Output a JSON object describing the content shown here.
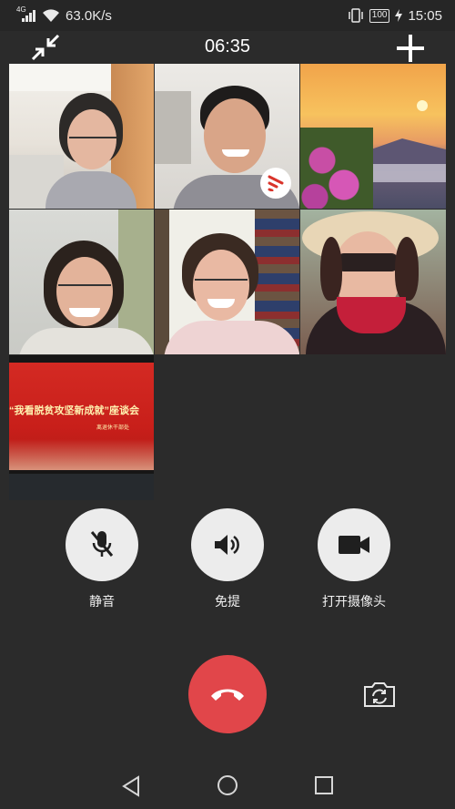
{
  "status_bar": {
    "network_type": "4G",
    "speed": "63.0K/s",
    "battery": "100",
    "time": "15:05"
  },
  "call": {
    "timer": "06:35"
  },
  "banner": {
    "title": "“我看脱贫攻坚新成就”座谈会",
    "subtitle": "离退休干部处"
  },
  "controls": {
    "mute_label": "静音",
    "speaker_label": "免提",
    "camera_label": "打开摄像头"
  },
  "colors": {
    "background": "#2b2b2b",
    "hangup": "#e1464a",
    "control_circle": "#ececec",
    "speaking_badge": "#d9342b"
  }
}
